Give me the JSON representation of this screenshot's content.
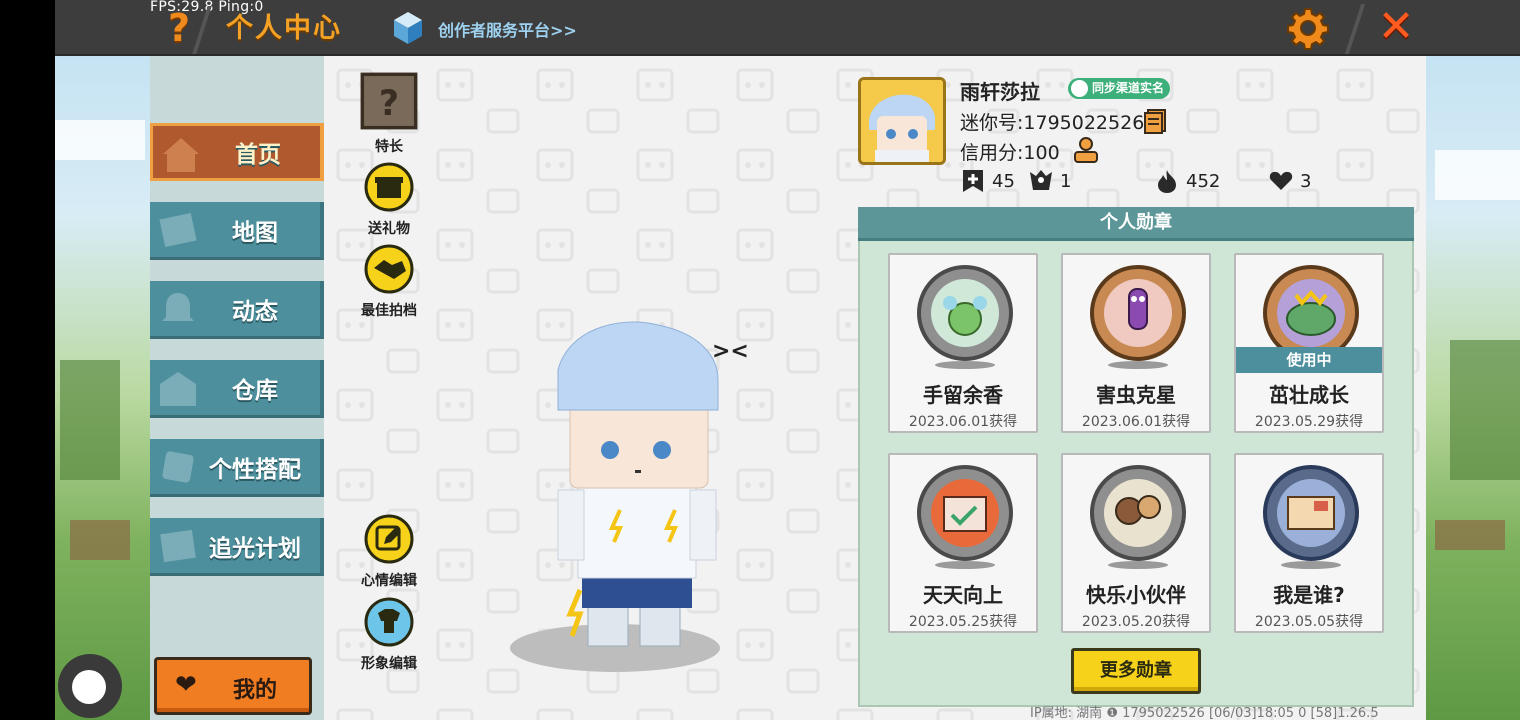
{
  "hud": {
    "fps": "FPS:29.8  Ping:0"
  },
  "topbar": {
    "help_label": "?",
    "title": "个人中心",
    "creator_link": "创作者服务平台>>",
    "close_label": "✕"
  },
  "nav": {
    "items": [
      {
        "label": "首页",
        "icon": "home-icon",
        "active": true
      },
      {
        "label": "地图",
        "icon": "map-icon"
      },
      {
        "label": "动态",
        "icon": "bell-icon"
      },
      {
        "label": "仓库",
        "icon": "warehouse-icon"
      },
      {
        "label": "个性搭配",
        "icon": "outfit-icon"
      },
      {
        "label": "追光计划",
        "icon": "light-plan-icon"
      }
    ],
    "mine_label": "我的"
  },
  "actions": {
    "specialty": "特长",
    "gift": "送礼物",
    "partner": "最佳拍档",
    "mood_edit": "心情编辑",
    "look_edit": "形象编辑"
  },
  "profile": {
    "name": "雨轩莎拉",
    "sync_badge": "同步渠道实名",
    "mini_id": "迷你号:1795022526",
    "credit": "信用分:100",
    "stats": {
      "likes": "45",
      "fans": "1",
      "heat": "452",
      "hearts": "3"
    }
  },
  "medals": {
    "header": "个人勋章",
    "in_use_label": "使用中",
    "items": [
      {
        "name": "手留余香",
        "date": "2023.06.01获得"
      },
      {
        "name": "害虫克星",
        "date": "2023.06.01获得"
      },
      {
        "name": "茁壮成长",
        "date": "2023.05.29获得",
        "in_use": true
      },
      {
        "name": "天天向上",
        "date": "2023.05.25获得"
      },
      {
        "name": "快乐小伙伴",
        "date": "2023.05.20获得"
      },
      {
        "name": "我是谁?",
        "date": "2023.05.05获得"
      }
    ],
    "more_label": "更多勋章"
  },
  "footer": "IP属地: 湖南 ❶    1795022526    [06/03]18:05 0   [58]1.26.5",
  "colors": {
    "accent_orange": "#f08a1c",
    "nav_teal": "#4d8f9c",
    "medal_header": "#5c9698",
    "more_button": "#f7d21a"
  }
}
